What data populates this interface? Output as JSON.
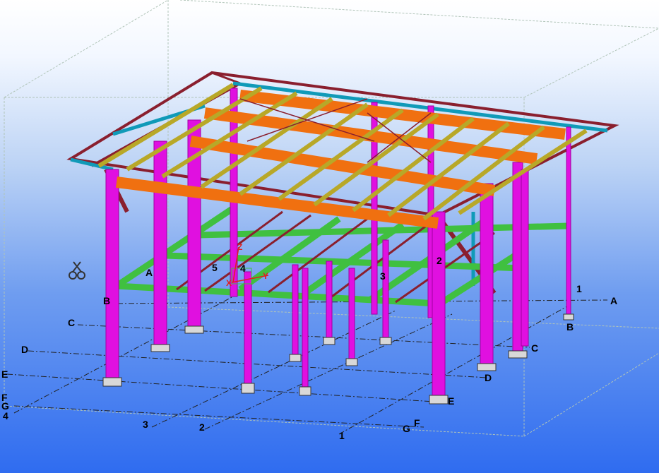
{
  "viewport": {
    "background_top": "#ffffff",
    "background_bottom": "#2f6cf0",
    "grid_labels": {
      "rows_right": [
        "A",
        "B",
        "C",
        "D",
        "E"
      ],
      "rows_left": [
        "C",
        "D",
        "E",
        "F",
        "G"
      ],
      "cols_front": [
        "4",
        "3",
        "2",
        "1"
      ],
      "front_right": [
        "F",
        "G"
      ],
      "interior": [
        "A",
        "5",
        "4",
        "3",
        "2",
        "1"
      ],
      "left_col_label": "B"
    },
    "axis": {
      "x_label": "X",
      "y_label": "Y",
      "z_label": "Z"
    },
    "colors": {
      "column": "#e010e0",
      "roof_beam": "#f07010",
      "purlin": "#b8a828",
      "floor_beam": "#40c040",
      "rafter": "#8a1f2e",
      "eave": "#109ab8",
      "work_area": "#b0c4b8"
    },
    "icons": [
      "scissors-icon"
    ]
  }
}
